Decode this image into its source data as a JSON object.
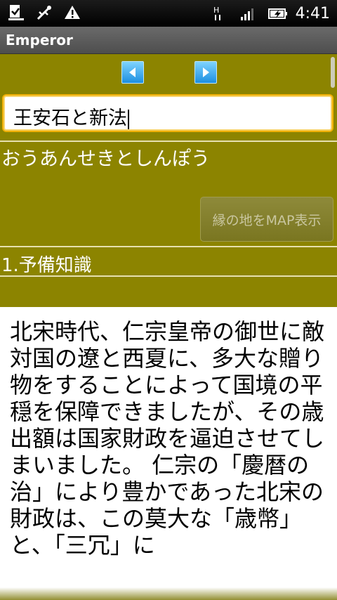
{
  "status": {
    "time": "4:41"
  },
  "app": {
    "title": "Emperor"
  },
  "entry": {
    "title": "王安石と新法",
    "reading": "おうあんせきとしんぽう",
    "map_button": "縁の地をMAP表示",
    "section": "1.予備知識",
    "body": "北宋時代、仁宗皇帝の御世に敵対国の遼と西夏に、多大な贈り物をすることによって国境の平穏を保障できましたが、その歳出額は国家財政を逼迫させてしまいました。 仁宗の「慶暦の治」により豊かであった北宋の財政は、この莫大な「歳幣」と、「三冗」に"
  },
  "colors": {
    "background": "#8c8400",
    "accent": "#1d8fe0",
    "focus": "#f0b000"
  },
  "icons": [
    "download-icon",
    "usb-debug-icon",
    "warning-icon",
    "hspa-icon",
    "signal-icon",
    "battery-charging-icon",
    "prev-arrow-icon",
    "next-arrow-icon"
  ]
}
